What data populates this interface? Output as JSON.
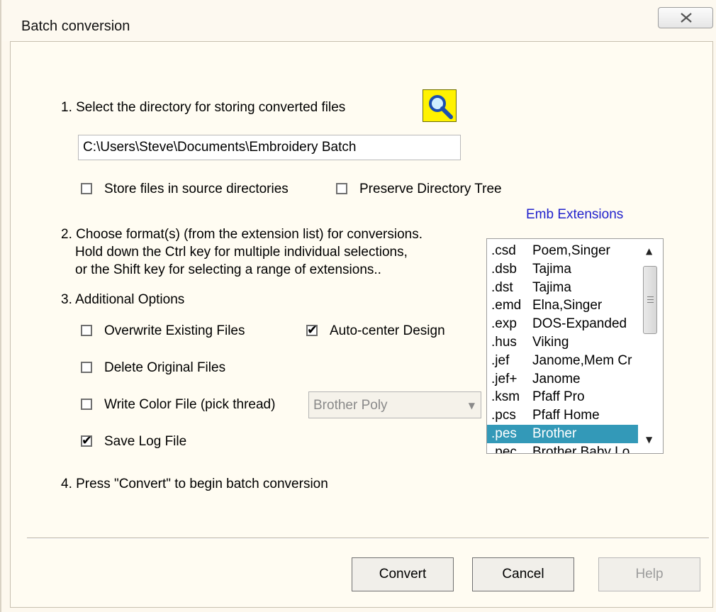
{
  "window": {
    "title": "Batch conversion"
  },
  "step1": {
    "label": "1. Select the directory for storing converted files",
    "directory_value": "C:\\Users\\Steve\\Documents\\Embroidery Batch",
    "store_in_source_label": "Store files in source directories",
    "store_in_source_checked": false,
    "preserve_tree_label": "Preserve Directory Tree",
    "preserve_tree_checked": false
  },
  "step2": {
    "line1": "2. Choose format(s) (from the extension list) for conversions.",
    "line2": "Hold down the Ctrl key for multiple individual selections,",
    "line3": "or the Shift key for selecting a range of extensions.."
  },
  "extensions": {
    "header": "Emb Extensions",
    "items": [
      {
        "ext": ".csd",
        "brand": "Poem,Singer",
        "selected": false
      },
      {
        "ext": ".dsb",
        "brand": "Tajima",
        "selected": false
      },
      {
        "ext": ".dst",
        "brand": "Tajima",
        "selected": false
      },
      {
        "ext": ".emd",
        "brand": "Elna,Singer",
        "selected": false
      },
      {
        "ext": ".exp",
        "brand": "DOS-Expanded",
        "selected": false
      },
      {
        "ext": ".hus",
        "brand": "Viking",
        "selected": false
      },
      {
        "ext": ".jef",
        "brand": "Janome,Mem Cr",
        "selected": false
      },
      {
        "ext": ".jef+",
        "brand": "Janome",
        "selected": false
      },
      {
        "ext": ".ksm",
        "brand": "Pfaff Pro",
        "selected": false
      },
      {
        "ext": ".pcs",
        "brand": "Pfaff Home",
        "selected": false
      },
      {
        "ext": ".pes",
        "brand": "Brother",
        "selected": true
      },
      {
        "ext": ".pec",
        "brand": "Brother Baby Lo",
        "selected": false
      }
    ],
    "selected_color": "#3399b8"
  },
  "step3": {
    "label": "3. Additional Options",
    "overwrite_label": "Overwrite Existing Files",
    "overwrite_checked": false,
    "autocenter_label": "Auto-center Design",
    "autocenter_checked": true,
    "delete_label": "Delete Original Files",
    "delete_checked": false,
    "color_file_label": "Write Color File (pick thread)",
    "color_file_checked": false,
    "thread_value": "Brother Poly",
    "save_log_label": "Save Log File",
    "save_log_checked": true
  },
  "step4": {
    "label": "4. Press \"Convert\" to begin batch conversion"
  },
  "buttons": {
    "convert": "Convert",
    "cancel": "Cancel",
    "help": "Help"
  },
  "icons": {
    "browse": "magnifier-icon",
    "close": "close-icon"
  },
  "colors": {
    "accent_link": "#2222cc",
    "browse_bg": "#fff200"
  }
}
